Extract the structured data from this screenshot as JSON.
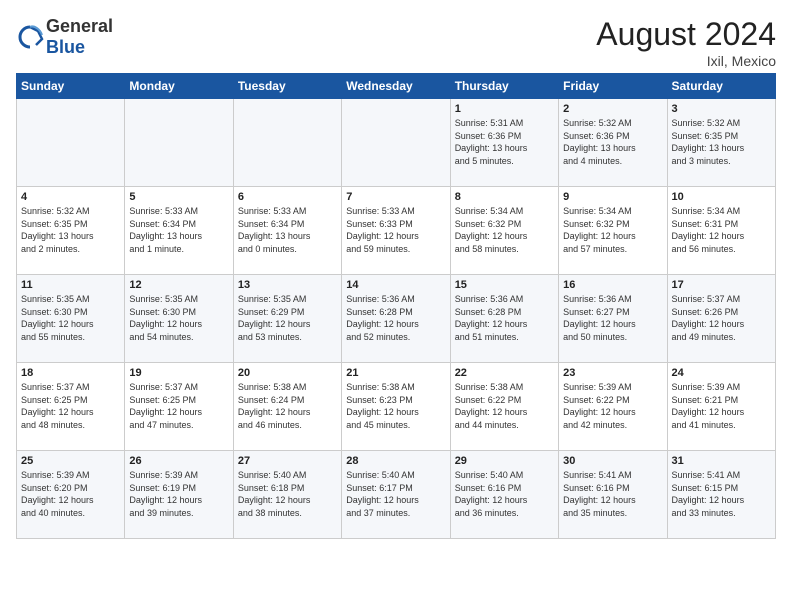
{
  "header": {
    "logo_general": "General",
    "logo_blue": "Blue",
    "month_year": "August 2024",
    "location": "Ixil, Mexico"
  },
  "days_of_week": [
    "Sunday",
    "Monday",
    "Tuesday",
    "Wednesday",
    "Thursday",
    "Friday",
    "Saturday"
  ],
  "weeks": [
    [
      {
        "day": "",
        "info": ""
      },
      {
        "day": "",
        "info": ""
      },
      {
        "day": "",
        "info": ""
      },
      {
        "day": "",
        "info": ""
      },
      {
        "day": "1",
        "info": "Sunrise: 5:31 AM\nSunset: 6:36 PM\nDaylight: 13 hours\nand 5 minutes."
      },
      {
        "day": "2",
        "info": "Sunrise: 5:32 AM\nSunset: 6:36 PM\nDaylight: 13 hours\nand 4 minutes."
      },
      {
        "day": "3",
        "info": "Sunrise: 5:32 AM\nSunset: 6:35 PM\nDaylight: 13 hours\nand 3 minutes."
      }
    ],
    [
      {
        "day": "4",
        "info": "Sunrise: 5:32 AM\nSunset: 6:35 PM\nDaylight: 13 hours\nand 2 minutes."
      },
      {
        "day": "5",
        "info": "Sunrise: 5:33 AM\nSunset: 6:34 PM\nDaylight: 13 hours\nand 1 minute."
      },
      {
        "day": "6",
        "info": "Sunrise: 5:33 AM\nSunset: 6:34 PM\nDaylight: 13 hours\nand 0 minutes."
      },
      {
        "day": "7",
        "info": "Sunrise: 5:33 AM\nSunset: 6:33 PM\nDaylight: 12 hours\nand 59 minutes."
      },
      {
        "day": "8",
        "info": "Sunrise: 5:34 AM\nSunset: 6:32 PM\nDaylight: 12 hours\nand 58 minutes."
      },
      {
        "day": "9",
        "info": "Sunrise: 5:34 AM\nSunset: 6:32 PM\nDaylight: 12 hours\nand 57 minutes."
      },
      {
        "day": "10",
        "info": "Sunrise: 5:34 AM\nSunset: 6:31 PM\nDaylight: 12 hours\nand 56 minutes."
      }
    ],
    [
      {
        "day": "11",
        "info": "Sunrise: 5:35 AM\nSunset: 6:30 PM\nDaylight: 12 hours\nand 55 minutes."
      },
      {
        "day": "12",
        "info": "Sunrise: 5:35 AM\nSunset: 6:30 PM\nDaylight: 12 hours\nand 54 minutes."
      },
      {
        "day": "13",
        "info": "Sunrise: 5:35 AM\nSunset: 6:29 PM\nDaylight: 12 hours\nand 53 minutes."
      },
      {
        "day": "14",
        "info": "Sunrise: 5:36 AM\nSunset: 6:28 PM\nDaylight: 12 hours\nand 52 minutes."
      },
      {
        "day": "15",
        "info": "Sunrise: 5:36 AM\nSunset: 6:28 PM\nDaylight: 12 hours\nand 51 minutes."
      },
      {
        "day": "16",
        "info": "Sunrise: 5:36 AM\nSunset: 6:27 PM\nDaylight: 12 hours\nand 50 minutes."
      },
      {
        "day": "17",
        "info": "Sunrise: 5:37 AM\nSunset: 6:26 PM\nDaylight: 12 hours\nand 49 minutes."
      }
    ],
    [
      {
        "day": "18",
        "info": "Sunrise: 5:37 AM\nSunset: 6:25 PM\nDaylight: 12 hours\nand 48 minutes."
      },
      {
        "day": "19",
        "info": "Sunrise: 5:37 AM\nSunset: 6:25 PM\nDaylight: 12 hours\nand 47 minutes."
      },
      {
        "day": "20",
        "info": "Sunrise: 5:38 AM\nSunset: 6:24 PM\nDaylight: 12 hours\nand 46 minutes."
      },
      {
        "day": "21",
        "info": "Sunrise: 5:38 AM\nSunset: 6:23 PM\nDaylight: 12 hours\nand 45 minutes."
      },
      {
        "day": "22",
        "info": "Sunrise: 5:38 AM\nSunset: 6:22 PM\nDaylight: 12 hours\nand 44 minutes."
      },
      {
        "day": "23",
        "info": "Sunrise: 5:39 AM\nSunset: 6:22 PM\nDaylight: 12 hours\nand 42 minutes."
      },
      {
        "day": "24",
        "info": "Sunrise: 5:39 AM\nSunset: 6:21 PM\nDaylight: 12 hours\nand 41 minutes."
      }
    ],
    [
      {
        "day": "25",
        "info": "Sunrise: 5:39 AM\nSunset: 6:20 PM\nDaylight: 12 hours\nand 40 minutes."
      },
      {
        "day": "26",
        "info": "Sunrise: 5:39 AM\nSunset: 6:19 PM\nDaylight: 12 hours\nand 39 minutes."
      },
      {
        "day": "27",
        "info": "Sunrise: 5:40 AM\nSunset: 6:18 PM\nDaylight: 12 hours\nand 38 minutes."
      },
      {
        "day": "28",
        "info": "Sunrise: 5:40 AM\nSunset: 6:17 PM\nDaylight: 12 hours\nand 37 minutes."
      },
      {
        "day": "29",
        "info": "Sunrise: 5:40 AM\nSunset: 6:16 PM\nDaylight: 12 hours\nand 36 minutes."
      },
      {
        "day": "30",
        "info": "Sunrise: 5:41 AM\nSunset: 6:16 PM\nDaylight: 12 hours\nand 35 minutes."
      },
      {
        "day": "31",
        "info": "Sunrise: 5:41 AM\nSunset: 6:15 PM\nDaylight: 12 hours\nand 33 minutes."
      }
    ]
  ]
}
